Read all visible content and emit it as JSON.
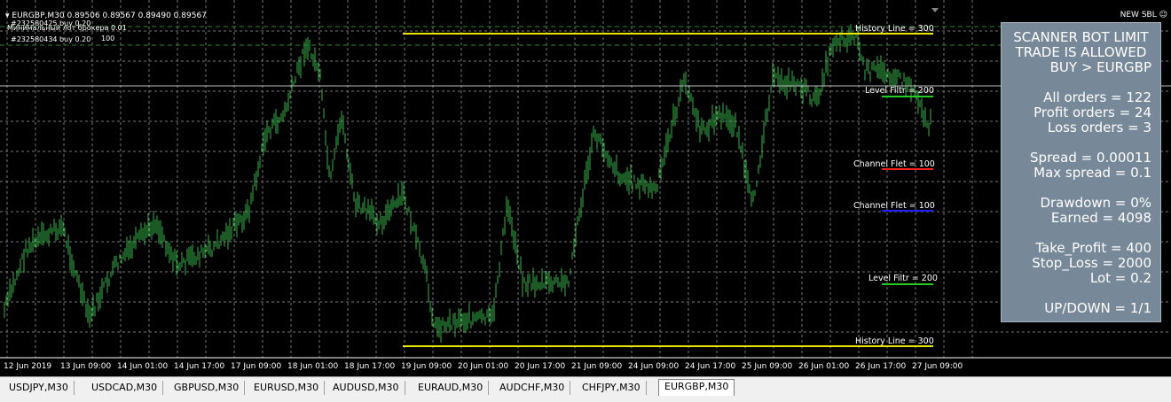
{
  "chart": {
    "symbol_line": "EURGBP,M30  0.89506 0.89567 0.89490 0.89567",
    "info_line1": "#232580425 buy 0.20",
    "info_line2": "Минимальный лот брокера    0.01",
    "info_line3": "#232580434 buy 0.20",
    "info_line4": "100",
    "new_sbl": "NEW SBL",
    "history_line_top": "History Line = 300",
    "history_line_bottom": "History Line = 300",
    "level_filtr_top": "Level Filtr = 200",
    "level_filtr_bottom": "Level Filtr = 200",
    "channel_flet_red": "Channel Flet = 100",
    "channel_flet_blue": "Channel Flet = 100",
    "colors": {
      "background": "#000000",
      "candles": "#39b54a",
      "grid": "#8a8a8a",
      "yellow": "#e8e800",
      "red": "#ff2020",
      "blue": "#2020ff",
      "green": "#22cc22",
      "panel": "#778899"
    }
  },
  "panel": {
    "line1": "SCANNER BOT LIMIT",
    "line2": "TRADE IS ALLOWED",
    "line3": "BUY > EURGBP",
    "all_orders": "All orders = 122",
    "profit_orders": "Profit orders = 24",
    "loss_orders": "Loss orders = 3",
    "spread": "Spread =  0.00011",
    "max_spread": "Max spread =  0.1",
    "drawdown": "Drawdown  = 0%",
    "earned": "Earned = 4098",
    "take_profit": "Take_Profit = 400",
    "stop_loss": "Stop_Loss = 2000",
    "lot": "Lot = 0.2",
    "updown": "UP/DOWN = 1/1"
  },
  "time_axis": [
    "12 Jun 2019",
    "13 Jun 09:00",
    "14 Jun 01:00",
    "14 Jun 17:00",
    "17 Jun 09:00",
    "18 Jun 01:00",
    "18 Jun 17:00",
    "19 Jun 09:00",
    "20 Jun 01:00",
    "20 Jun 17:00",
    "21 Jun 09:00",
    "24 Jun 09:00",
    "24 Jun 17:00",
    "25 Jun 09:00",
    "26 Jun 01:00",
    "26 Jun 17:00",
    "27 Jun 09:00"
  ],
  "tabs": [
    "USDJPY,M30",
    "USDCAD,M30",
    "GBPUSD,M30",
    "EURUSD,M30",
    "AUDUSD,M30",
    "EURAUD,M30",
    "AUDCHF,M30",
    "CHFJPY,M30",
    "EURGBP,M30"
  ],
  "active_tab": "EURGBP,M30"
}
